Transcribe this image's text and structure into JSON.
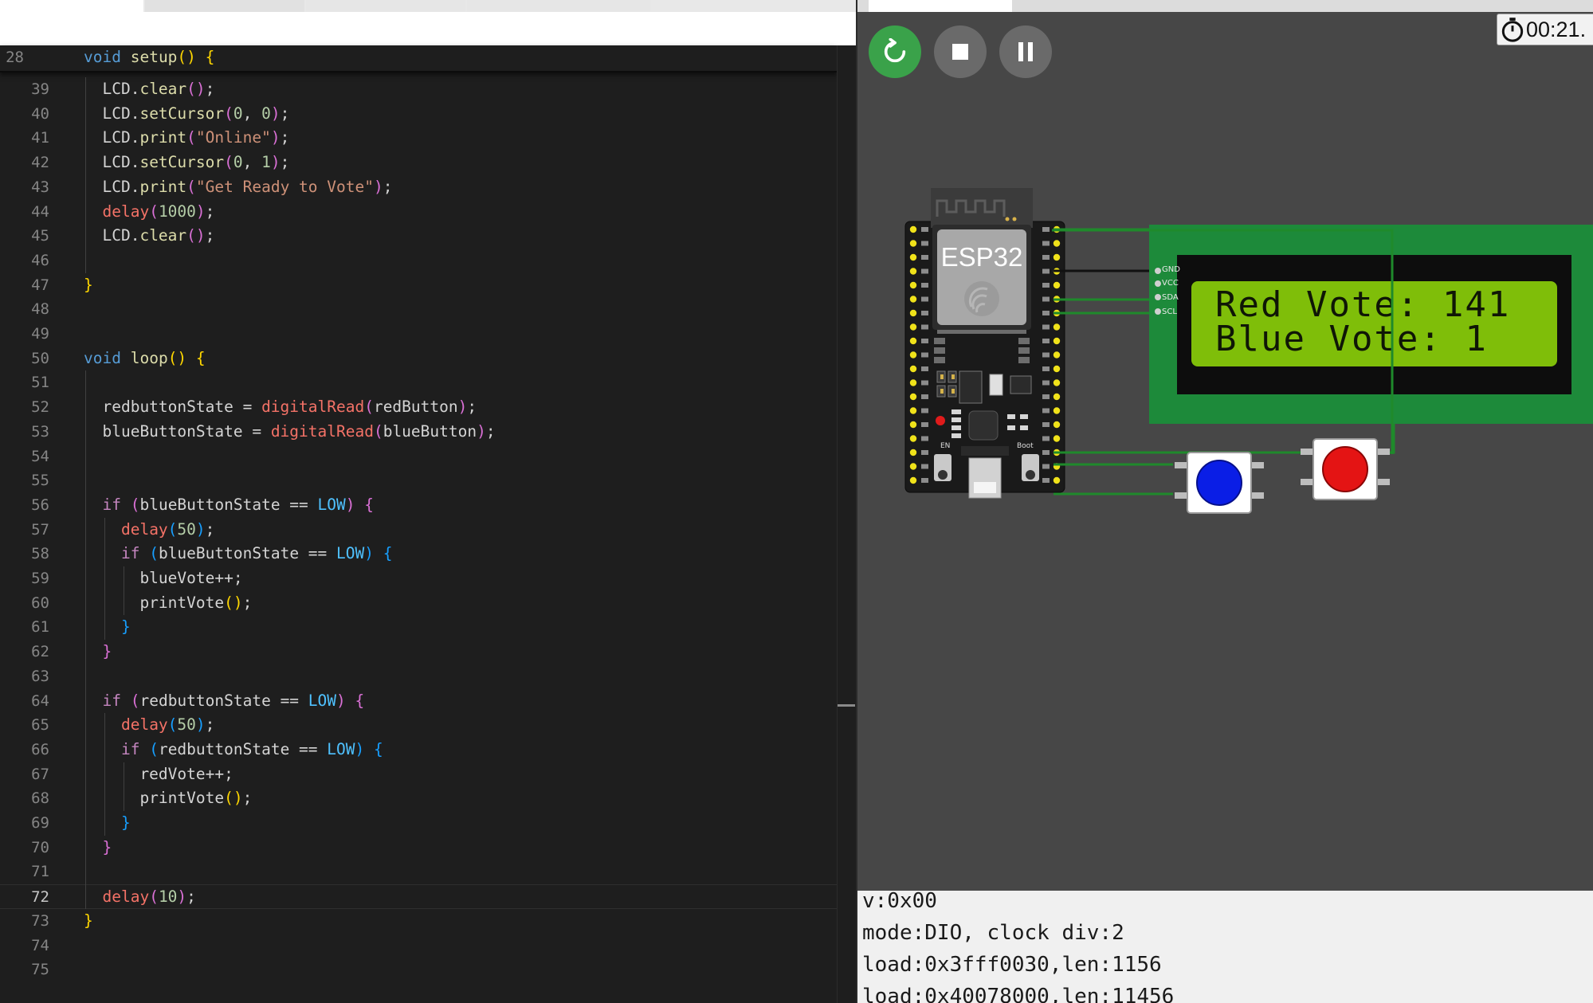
{
  "editor": {
    "sticky_line_number": "28",
    "sticky": [
      [
        "kw",
        "void"
      ],
      [
        "t",
        " "
      ],
      [
        "fn",
        "setup"
      ],
      [
        "b1",
        "()"
      ],
      [
        "t",
        " "
      ],
      [
        "b1",
        "{"
      ]
    ],
    "lines": [
      {
        "n": "39",
        "tokens": [
          [
            "t",
            "  LCD."
          ],
          [
            "fn",
            "clear"
          ],
          [
            "b2",
            "()"
          ],
          [
            "t",
            ";"
          ]
        ]
      },
      {
        "n": "40",
        "tokens": [
          [
            "t",
            "  LCD."
          ],
          [
            "fn",
            "setCursor"
          ],
          [
            "b2",
            "("
          ],
          [
            "num",
            "0"
          ],
          [
            "t",
            ", "
          ],
          [
            "num",
            "0"
          ],
          [
            "b2",
            ")"
          ],
          [
            "t",
            ";"
          ]
        ]
      },
      {
        "n": "41",
        "tokens": [
          [
            "t",
            "  LCD."
          ],
          [
            "fn",
            "print"
          ],
          [
            "b2",
            "("
          ],
          [
            "str",
            "\"Online\""
          ],
          [
            "b2",
            ")"
          ],
          [
            "t",
            ";"
          ]
        ]
      },
      {
        "n": "42",
        "tokens": [
          [
            "t",
            "  LCD."
          ],
          [
            "fn",
            "setCursor"
          ],
          [
            "b2",
            "("
          ],
          [
            "num",
            "0"
          ],
          [
            "t",
            ", "
          ],
          [
            "num",
            "1"
          ],
          [
            "b2",
            ")"
          ],
          [
            "t",
            ";"
          ]
        ]
      },
      {
        "n": "43",
        "tokens": [
          [
            "t",
            "  LCD."
          ],
          [
            "fn",
            "print"
          ],
          [
            "b2",
            "("
          ],
          [
            "str",
            "\"Get Ready to Vote\""
          ],
          [
            "b2",
            ")"
          ],
          [
            "t",
            ";"
          ]
        ]
      },
      {
        "n": "44",
        "tokens": [
          [
            "t",
            "  "
          ],
          [
            "call",
            "delay"
          ],
          [
            "b2",
            "("
          ],
          [
            "num",
            "1000"
          ],
          [
            "b2",
            ")"
          ],
          [
            "t",
            ";"
          ]
        ]
      },
      {
        "n": "45",
        "tokens": [
          [
            "t",
            "  LCD."
          ],
          [
            "fn",
            "clear"
          ],
          [
            "b2",
            "()"
          ],
          [
            "t",
            ";"
          ]
        ]
      },
      {
        "n": "46",
        "tokens": []
      },
      {
        "n": "47",
        "tokens": [
          [
            "b1",
            "}"
          ]
        ]
      },
      {
        "n": "48",
        "tokens": []
      },
      {
        "n": "49",
        "tokens": []
      },
      {
        "n": "50",
        "tokens": [
          [
            "kw",
            "void"
          ],
          [
            "t",
            " "
          ],
          [
            "fn",
            "loop"
          ],
          [
            "b1",
            "()"
          ],
          [
            "t",
            " "
          ],
          [
            "b1",
            "{"
          ]
        ]
      },
      {
        "n": "51",
        "tokens": []
      },
      {
        "n": "52",
        "tokens": [
          [
            "t",
            "  redbuttonState = "
          ],
          [
            "call",
            "digitalRead"
          ],
          [
            "b2",
            "("
          ],
          [
            "t",
            "redButton"
          ],
          [
            "b2",
            ")"
          ],
          [
            "t",
            ";"
          ]
        ]
      },
      {
        "n": "53",
        "tokens": [
          [
            "t",
            "  blueButtonState = "
          ],
          [
            "call",
            "digitalRead"
          ],
          [
            "b2",
            "("
          ],
          [
            "t",
            "blueButton"
          ],
          [
            "b2",
            ")"
          ],
          [
            "t",
            ";"
          ]
        ]
      },
      {
        "n": "54",
        "tokens": []
      },
      {
        "n": "55",
        "tokens": []
      },
      {
        "n": "56",
        "tokens": [
          [
            "t",
            "  "
          ],
          [
            "kwi",
            "if"
          ],
          [
            "t",
            " "
          ],
          [
            "b2",
            "("
          ],
          [
            "t",
            "blueButtonState == "
          ],
          [
            "cst",
            "LOW"
          ],
          [
            "b2",
            ")"
          ],
          [
            "t",
            " "
          ],
          [
            "b2",
            "{"
          ]
        ]
      },
      {
        "n": "57",
        "tokens": [
          [
            "t",
            "    "
          ],
          [
            "call",
            "delay"
          ],
          [
            "b3",
            "("
          ],
          [
            "num",
            "50"
          ],
          [
            "b3",
            ")"
          ],
          [
            "t",
            ";"
          ]
        ]
      },
      {
        "n": "58",
        "tokens": [
          [
            "t",
            "    "
          ],
          [
            "kwi",
            "if"
          ],
          [
            "t",
            " "
          ],
          [
            "b3",
            "("
          ],
          [
            "t",
            "blueButtonState == "
          ],
          [
            "cst",
            "LOW"
          ],
          [
            "b3",
            ")"
          ],
          [
            "t",
            " "
          ],
          [
            "b3",
            "{"
          ]
        ]
      },
      {
        "n": "59",
        "tokens": [
          [
            "t",
            "      blueVote++;"
          ]
        ]
      },
      {
        "n": "60",
        "tokens": [
          [
            "t",
            "      printVote"
          ],
          [
            "b1",
            "()"
          ],
          [
            "t",
            ";"
          ]
        ]
      },
      {
        "n": "61",
        "tokens": [
          [
            "t",
            "    "
          ],
          [
            "b3",
            "}"
          ]
        ]
      },
      {
        "n": "62",
        "tokens": [
          [
            "t",
            "  "
          ],
          [
            "b2",
            "}"
          ]
        ]
      },
      {
        "n": "63",
        "tokens": []
      },
      {
        "n": "64",
        "tokens": [
          [
            "t",
            "  "
          ],
          [
            "kwi",
            "if"
          ],
          [
            "t",
            " "
          ],
          [
            "b2",
            "("
          ],
          [
            "t",
            "redbuttonState == "
          ],
          [
            "cst",
            "LOW"
          ],
          [
            "b2",
            ")"
          ],
          [
            "t",
            " "
          ],
          [
            "b2",
            "{"
          ]
        ]
      },
      {
        "n": "65",
        "tokens": [
          [
            "t",
            "    "
          ],
          [
            "call",
            "delay"
          ],
          [
            "b3",
            "("
          ],
          [
            "num",
            "50"
          ],
          [
            "b3",
            ")"
          ],
          [
            "t",
            ";"
          ]
        ]
      },
      {
        "n": "66",
        "tokens": [
          [
            "t",
            "    "
          ],
          [
            "kwi",
            "if"
          ],
          [
            "t",
            " "
          ],
          [
            "b3",
            "("
          ],
          [
            "t",
            "redbuttonState == "
          ],
          [
            "cst",
            "LOW"
          ],
          [
            "b3",
            ")"
          ],
          [
            "t",
            " "
          ],
          [
            "b3",
            "{"
          ]
        ]
      },
      {
        "n": "67",
        "tokens": [
          [
            "t",
            "      redVote++;"
          ]
        ]
      },
      {
        "n": "68",
        "tokens": [
          [
            "t",
            "      printVote"
          ],
          [
            "b1",
            "()"
          ],
          [
            "t",
            ";"
          ]
        ]
      },
      {
        "n": "69",
        "tokens": [
          [
            "t",
            "    "
          ],
          [
            "b3",
            "}"
          ]
        ]
      },
      {
        "n": "70",
        "tokens": [
          [
            "t",
            "  "
          ],
          [
            "b2",
            "}"
          ]
        ]
      },
      {
        "n": "71",
        "tokens": []
      },
      {
        "n": "72",
        "tokens": [
          [
            "t",
            "  "
          ],
          [
            "call",
            "delay"
          ],
          [
            "b2",
            "("
          ],
          [
            "num",
            "10"
          ],
          [
            "b2",
            ")"
          ],
          [
            "t",
            ";"
          ]
        ]
      },
      {
        "n": "73",
        "tokens": [
          [
            "b1",
            "}"
          ]
        ]
      },
      {
        "n": "74",
        "tokens": []
      },
      {
        "n": "75",
        "tokens": []
      }
    ],
    "current_line": "72"
  },
  "simulator": {
    "timer": "00:21.",
    "restart_icon": "restart-icon",
    "stop_icon": "stop-icon",
    "pause_icon": "pause-icon",
    "board_label": "ESP32",
    "lcd": {
      "line1": "Red Vote: 141",
      "line2": "Blue Vote: 1",
      "pins": [
        "GND",
        "VCC",
        "SDA",
        "SCL"
      ]
    },
    "button_colors": {
      "blue": "#0a1ee6",
      "red": "#e41414"
    }
  },
  "console": {
    "lines": [
      "v:0x00",
      "mode:DIO, clock div:2",
      "load:0x3fff0030,len:1156",
      "load:0x40078000,len:11456"
    ]
  }
}
